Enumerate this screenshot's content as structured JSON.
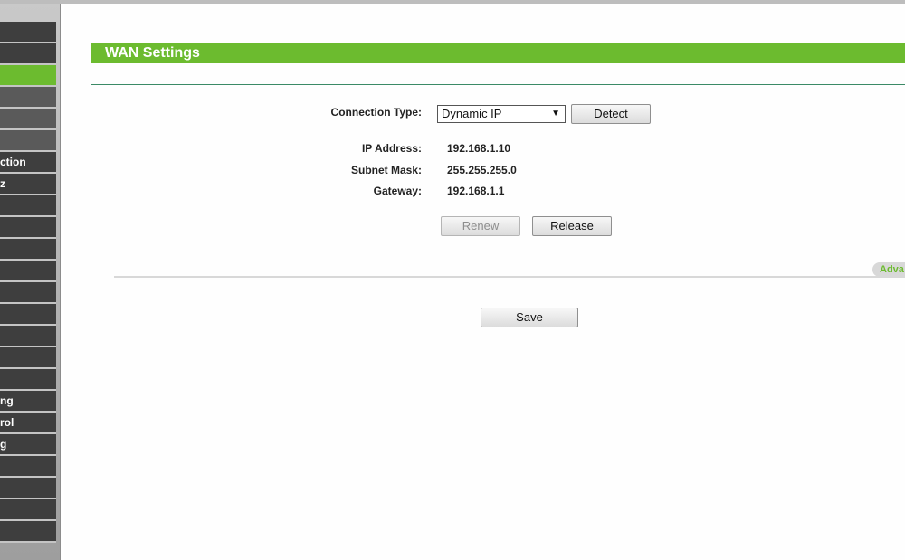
{
  "sidebar": {
    "items": [
      {
        "label": ""
      },
      {
        "label": ""
      },
      {
        "label": ""
      },
      {
        "label": ""
      },
      {
        "label": ""
      },
      {
        "label": ""
      },
      {
        "label": "ction"
      },
      {
        "label": "z"
      },
      {
        "label": ""
      },
      {
        "label": ""
      },
      {
        "label": ""
      },
      {
        "label": ""
      },
      {
        "label": ""
      },
      {
        "label": ""
      },
      {
        "label": ""
      },
      {
        "label": ""
      },
      {
        "label": ""
      },
      {
        "label": ""
      },
      {
        "label": "ng"
      },
      {
        "label": "rol"
      },
      {
        "label": "g"
      },
      {
        "label": ""
      },
      {
        "label": ""
      },
      {
        "label": ""
      },
      {
        "label": ""
      }
    ]
  },
  "page": {
    "title": "WAN Settings"
  },
  "form": {
    "connection_type_label": "Connection Type:",
    "connection_type_value": "Dynamic IP",
    "detect_label": "Detect",
    "ip_label": "IP Address:",
    "ip_value": "192.168.1.10",
    "mask_label": "Subnet Mask:",
    "mask_value": "255.255.255.0",
    "gateway_label": "Gateway:",
    "gateway_value": "192.168.1.1",
    "renew_label": "Renew",
    "release_label": "Release",
    "advanced_label": "Adva",
    "save_label": "Save"
  },
  "colors": {
    "accent": "#6cbb2f",
    "menu_dark": "#3e3e3e",
    "rule_green": "#3b8a66"
  }
}
